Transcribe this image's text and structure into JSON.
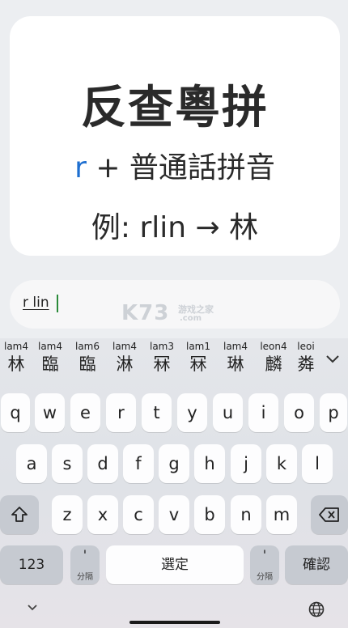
{
  "card": {
    "title": "反查粵拼",
    "line2_prefix": "r",
    "line2_rest": " + 普通話拼音",
    "line3": "例: rlin → 林"
  },
  "input": {
    "value": "r lin"
  },
  "watermark": {
    "text": "K73",
    "sub1": "游戏之家",
    "sub2": ".com"
  },
  "candidates": [
    {
      "romanization": "lam4",
      "char": "林"
    },
    {
      "romanization": "lam4",
      "char": "臨"
    },
    {
      "romanization": "lam6",
      "char": "臨"
    },
    {
      "romanization": "lam4",
      "char": "淋"
    },
    {
      "romanization": "lam3",
      "char": "冧"
    },
    {
      "romanization": "lam1",
      "char": "冧"
    },
    {
      "romanization": "lam4",
      "char": "琳"
    },
    {
      "romanization": "leon4",
      "char": "麟"
    },
    {
      "romanization": "leoi",
      "char": "粦"
    }
  ],
  "keyboard": {
    "row1": [
      "q",
      "w",
      "e",
      "r",
      "t",
      "y",
      "u",
      "i",
      "o",
      "p"
    ],
    "row2": [
      "a",
      "s",
      "d",
      "f",
      "g",
      "h",
      "j",
      "k",
      "l"
    ],
    "row3": [
      "z",
      "x",
      "c",
      "v",
      "b",
      "n",
      "m"
    ],
    "numbers_label": "123",
    "apostrophe_left": "'",
    "apostrophe_left_sub": "分隔",
    "space_label": "選定",
    "apostrophe_right": "'",
    "apostrophe_right_sub": "分隔",
    "confirm_label": "確認"
  },
  "icons": {
    "expand_candidates": "chevron-down-icon",
    "shift": "shift-icon",
    "backspace": "backspace-icon",
    "hide_keyboard": "chevron-down-icon",
    "language": "globe-icon"
  }
}
